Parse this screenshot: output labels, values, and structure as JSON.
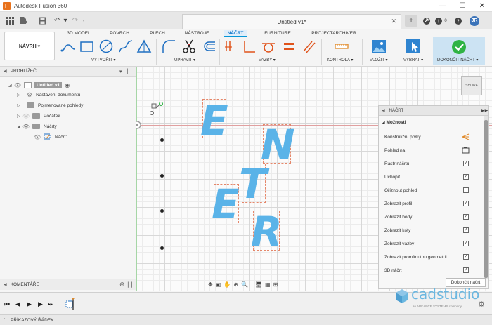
{
  "app": {
    "logo_letter": "F",
    "title": "Autodesk Fusion 360"
  },
  "window": {
    "minimize": "—",
    "maximize": "☐",
    "close": "✕"
  },
  "document": {
    "tab_title": "Untitled v1*",
    "close": "✕"
  },
  "header_icons": {
    "notifications": "0",
    "avatar_initials": "JR"
  },
  "workspace": {
    "label": "NÁVRH ▾"
  },
  "ribbon_tabs": [
    {
      "label": "3D MODEL"
    },
    {
      "label": "POVRCH"
    },
    {
      "label": "PLECH"
    },
    {
      "label": "NÁSTROJE"
    },
    {
      "label": "NÁČRT"
    },
    {
      "label": "FURNITURE"
    },
    {
      "label": "PROJECTARCHIVER"
    }
  ],
  "ribbon_groups": {
    "create": "VYTVOŘIT ▾",
    "modify": "UPRAVIT ▾",
    "constraints": "VAZBY ▾",
    "inspect": "KONTROLA ▾",
    "insert": "VLOŽIT ▾",
    "select": "VYBRAT ▾",
    "finish": "DOKONČIT NÁČRT ▾"
  },
  "browser": {
    "title": "PROHLÍŽEČ",
    "items": [
      {
        "label": "Untitled v1"
      },
      {
        "label": "Nastavení dokumentu"
      },
      {
        "label": "Pojmenované pohledy"
      },
      {
        "label": "Počátek"
      },
      {
        "label": "Náčrty"
      },
      {
        "label": "Náčrt1"
      }
    ]
  },
  "viewcube": {
    "label": "SHORA"
  },
  "canvas_letters": [
    "E",
    "N",
    "T",
    "E",
    "R"
  ],
  "palette": {
    "title": "NÁČRT",
    "section": "Možnosti",
    "options": [
      {
        "label": "Konstrukční prvky",
        "kind": "icon"
      },
      {
        "label": "Pohled na",
        "kind": "icon"
      },
      {
        "label": "Rastr náčrtu",
        "checked": true
      },
      {
        "label": "Uchopit",
        "checked": true
      },
      {
        "label": "Oříznout pohled",
        "checked": false
      },
      {
        "label": "Zobrazit profil",
        "checked": true
      },
      {
        "label": "Zobrazit body",
        "checked": true
      },
      {
        "label": "Zobrazit kóty",
        "checked": true
      },
      {
        "label": "Zobrazit vazby",
        "checked": true
      },
      {
        "label": "Zobrazit promítnutou geometrii",
        "checked": true
      },
      {
        "label": "3D náčrt",
        "checked": true
      }
    ],
    "finish_button": "Dokončit náčrt"
  },
  "comments": {
    "title": "KOMENTÁŘE"
  },
  "timeline": {
    "first": "⏮",
    "prev": "◀",
    "play": "▶",
    "next": "▶",
    "last": "⏭"
  },
  "brand": {
    "name": "cadstudio",
    "subtitle": "an ARKANCE SYSTEMS company"
  },
  "command_bar": {
    "label": "PŘÍKAZOVÝ ŘÁDEK"
  }
}
